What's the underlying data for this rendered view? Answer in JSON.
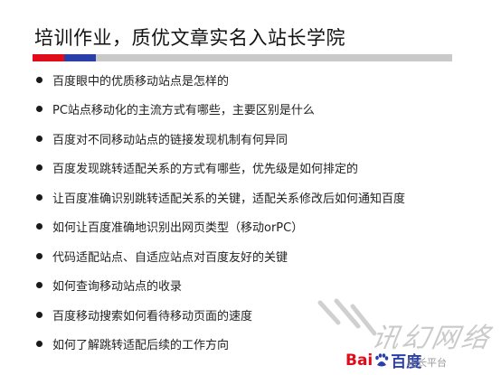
{
  "slide": {
    "title": "培训作业，质优文章实名入站长学院",
    "accent_colors": {
      "red": "#e10b19",
      "blue": "#2a3faa",
      "grey": "#c9c9c9"
    },
    "bullets": [
      "百度眼中的优质移动站点是怎样的",
      "PC站点移动化的主流方式有哪些，主要区别是什么",
      "百度对不同移动站点的链接发现机制有何异同",
      "百度发现跳转适配关系的方式有哪些，优先级是如何排定的",
      "让百度准确识别跳转适配关系的关键，适配关系修改后如何通知百度",
      "如何让百度准确地识别出网页类型（移动orPC）",
      "代码适配站点、自适应站点对百度友好的关键",
      "如何查询移动站点的收录",
      "百度移动搜索如何看待移动页面的速度",
      "如何了解跳转适配后续的工作方向"
    ]
  },
  "watermark": {
    "text": "讯幻网络",
    "logo_bai": "Bai",
    "logo_icon": "baidu-paw-icon",
    "logo_du": "百度",
    "platform_text": "站长平台"
  }
}
